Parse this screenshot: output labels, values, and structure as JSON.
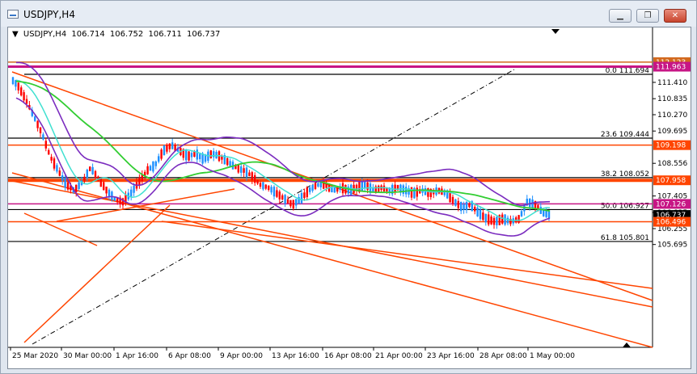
{
  "window": {
    "title": "USDJPY,H4",
    "buttons": {
      "minimize": "▁",
      "restore": "❐",
      "close": "✕"
    }
  },
  "symbol_info": {
    "symbol": "USDJPY,H4",
    "open": "106.714",
    "high": "106.752",
    "low": "106.711",
    "close": "106.737"
  },
  "price_axis": {
    "ticks": [
      "111.410",
      "110.835",
      "110.270",
      "109.695",
      "108.556",
      "107.405",
      "106.825",
      "106.255",
      "105.695"
    ]
  },
  "time_axis": {
    "ticks": [
      "25 Mar 2020",
      "30 Mar 00:00",
      "1 Apr 16:00",
      "6 Apr 08:00",
      "9 Apr 00:00",
      "13 Apr 16:00",
      "16 Apr 08:00",
      "21 Apr 00:00",
      "23 Apr 16:00",
      "28 Apr 08:00",
      "1 May 00:00"
    ]
  },
  "fibonacci": [
    {
      "label": "0.0 111.694",
      "value": 111.694
    },
    {
      "label": "23.6 109.444",
      "value": 109.444
    },
    {
      "label": "38.2 108.052",
      "value": 108.052
    },
    {
      "label": "50.0 106.927",
      "value": 106.927
    },
    {
      "label": "61.8 105.801",
      "value": 105.801
    }
  ],
  "price_tags": [
    {
      "label": "112.123",
      "value": 112.123,
      "color": "#d2691e"
    },
    {
      "label": "111.963",
      "value": 111.963,
      "color": "#c71585"
    },
    {
      "label": "109.198",
      "value": 109.198,
      "color": "#ff4500"
    },
    {
      "label": "107.958",
      "value": 107.958,
      "color": "#ff4500"
    },
    {
      "label": "107.126",
      "value": 107.126,
      "color": "#c71585"
    },
    {
      "label": "106.737",
      "value": 106.737,
      "color": "#000000"
    },
    {
      "label": "106.496",
      "value": 106.496,
      "color": "#ff4500"
    }
  ],
  "colors": {
    "bull_candle": "#1e90ff",
    "bear_candle": "#ff0000",
    "support_resistance": "#ff4500",
    "magenta_level": "#c71585",
    "fib_line": "#000000",
    "trend_channel": "#ff4500",
    "bollinger": "#7b2cbf",
    "ma_fast": "#40e0d0",
    "ma_slow": "#32cd32"
  }
}
